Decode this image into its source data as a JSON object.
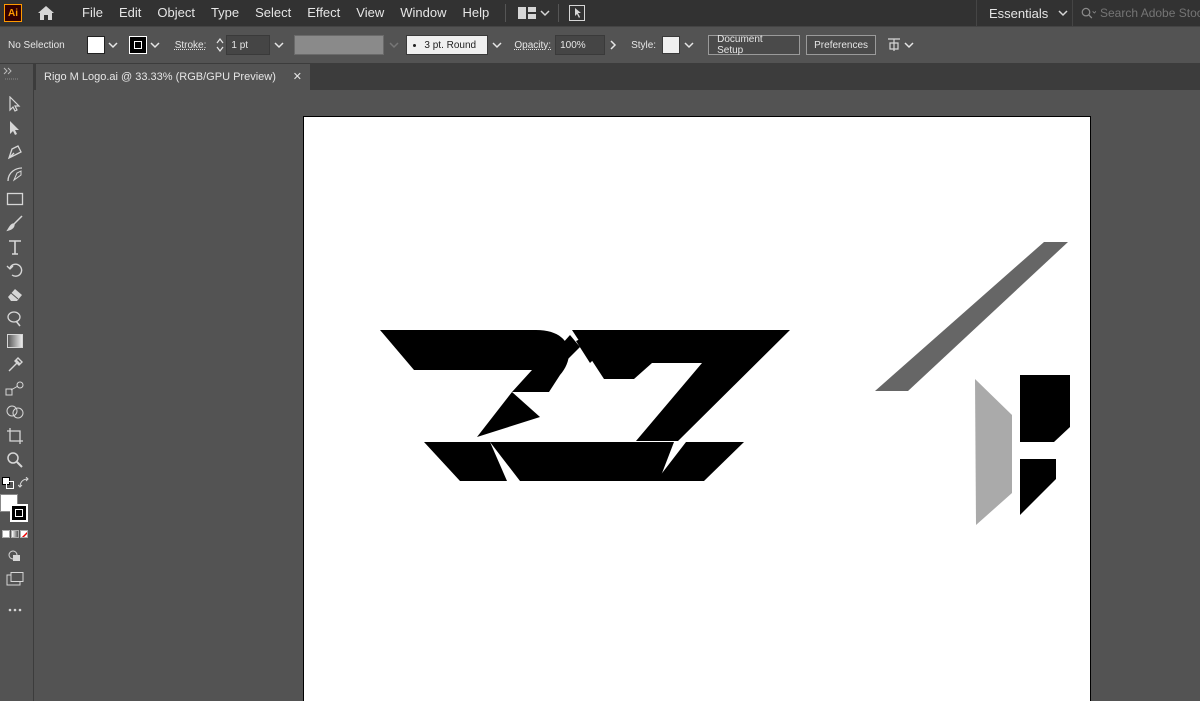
{
  "app": {
    "logo_text": "Ai"
  },
  "menu": {
    "items": [
      "File",
      "Edit",
      "Object",
      "Type",
      "Select",
      "Effect",
      "View",
      "Window",
      "Help"
    ]
  },
  "workspace": {
    "label": "Essentials"
  },
  "search": {
    "placeholder": "Search Adobe Stock"
  },
  "control_bar": {
    "selection_text": "No Selection",
    "fill_color": "#ffffff",
    "stroke_label": "Stroke:",
    "stroke_weight": "1 pt",
    "brush_label": "3 pt. Round",
    "opacity_label": "Opacity:",
    "opacity_value": "100%",
    "style_label": "Style:",
    "document_setup_label": "Document Setup",
    "preferences_label": "Preferences"
  },
  "document_tab": {
    "title": "Rigo M Logo.ai @ 33.33% (RGB/GPU Preview)",
    "close_glyph": "✕"
  },
  "tools": [
    "selection-tool",
    "direct-selection-tool",
    "pen-tool",
    "curvature-tool",
    "rectangle-tool",
    "paintbrush-tool",
    "type-tool",
    "rotate-tool",
    "eraser-tool",
    "warp-tool",
    "gradient-tool",
    "eyedropper-tool",
    "blend-tool",
    "shape-builder-tool",
    "artboard-tool",
    "zoom-tool"
  ],
  "colors": {
    "app_bg": "#535353",
    "menubar_bg": "#323232",
    "artboard_bg": "#ffffff",
    "logo_black": "#000000",
    "shape_dark_gray": "#666666",
    "shape_light_gray": "#aaaaaa",
    "brand_accent": "#ff9a00"
  }
}
